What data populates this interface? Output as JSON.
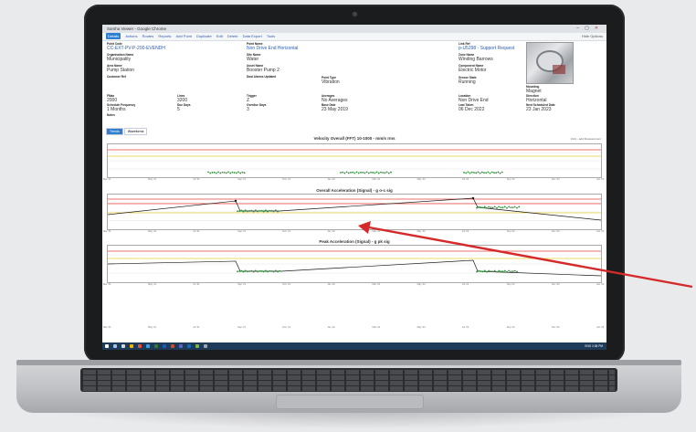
{
  "window": {
    "title": "Sarsha Viewer - Google Chrome"
  },
  "menu": {
    "items": [
      "Details",
      "Actions",
      "Routes",
      "Reports",
      "Add Point",
      "Duplicate",
      "Edit",
      "Delete",
      "Data Export",
      "Tools"
    ],
    "hide_options": "Hide Options"
  },
  "fields": {
    "point_code": {
      "label": "Point Code",
      "value": "CC-EXT-PV-P-200-EVENDH"
    },
    "point_name": {
      "label": "Point Name",
      "value": "Non Drive End Horizontal"
    },
    "link_ref": {
      "label": "Link Ref",
      "value": "p-U5298 - Support Request"
    },
    "organisation": {
      "label": "Organisation Name",
      "value": "Municipality"
    },
    "site_name": {
      "label": "Site Name",
      "value": "Water"
    },
    "zone_name": {
      "label": "Zone Name",
      "value": "Winding Barrows"
    },
    "area_name": {
      "label": "Area Name",
      "value": "Pump Station"
    },
    "asset_name": {
      "label": "Asset Name",
      "value": "Booster Pump 2"
    },
    "component_name": {
      "label": "Component Name",
      "value": "Electric Motor"
    },
    "customer_ref": {
      "label": "Customer Ref",
      "value": ""
    },
    "dual_alarms": {
      "label": "Dual Alarms Updated",
      "value": ""
    },
    "point_type": {
      "label": "Point Type",
      "value": "Vibration"
    },
    "sensor_state": {
      "label": "Sensor State",
      "value": "Running"
    },
    "mounting": {
      "label": "Mounting",
      "value": "Magnet"
    },
    "fmax": {
      "label": "FMax",
      "value": "2000"
    },
    "lines": {
      "label": "Lines",
      "value": "3200"
    },
    "trigger": {
      "label": "Trigger",
      "value": "Z"
    },
    "averages": {
      "label": "Averages",
      "value": "No Averages"
    },
    "location": {
      "label": "Location",
      "value": "Non Drive End"
    },
    "direction": {
      "label": "Direction",
      "value": "Horizontal"
    },
    "schedule_freq": {
      "label": "Schedule Frequency",
      "value": "1 Months"
    },
    "due_days": {
      "label": "Due Days",
      "value": "5"
    },
    "overdue_days": {
      "label": "Overdue Days",
      "value": "3"
    },
    "base_date": {
      "label": "Base Date",
      "value": "23 May 2019"
    },
    "last_taken": {
      "label": "Last Taken",
      "value": "06 Dec 2022"
    },
    "next_scheduled": {
      "label": "Next Scheduled Date",
      "value": "23 Jan 2023"
    },
    "notes": {
      "label": "Notes",
      "value": ""
    }
  },
  "tabs": [
    "Trends",
    "Waveforms"
  ],
  "charts": {
    "note": "Click - add Measurement",
    "titles": [
      "Velocity Overall (FFT) 10-1000 - mm/s rms",
      "Overall Acceleration (Signal) - g o-c sig",
      "Peak Acceleration (Signal) - g pk sig"
    ],
    "x_ticks": [
      "Mar '21",
      "May '21",
      "Jul '21",
      "Sep '21",
      "Nov '21",
      "Jan '22",
      "Mar '22",
      "May '22",
      "Jul '22",
      "Sep '22",
      "Nov '22",
      "Jan '23"
    ]
  },
  "colors": {
    "trend_line": "#1a1a1a",
    "trend_points": "#2e8b3a",
    "alarm_red": "#e8413a",
    "alarm_yellow": "#e9cf3a",
    "arrow": "#d42a2a",
    "taskbar": "#1f3b5a",
    "accent": "#2f7fd0"
  },
  "taskbar": {
    "tray_text": "ENG 2:38 PM"
  }
}
